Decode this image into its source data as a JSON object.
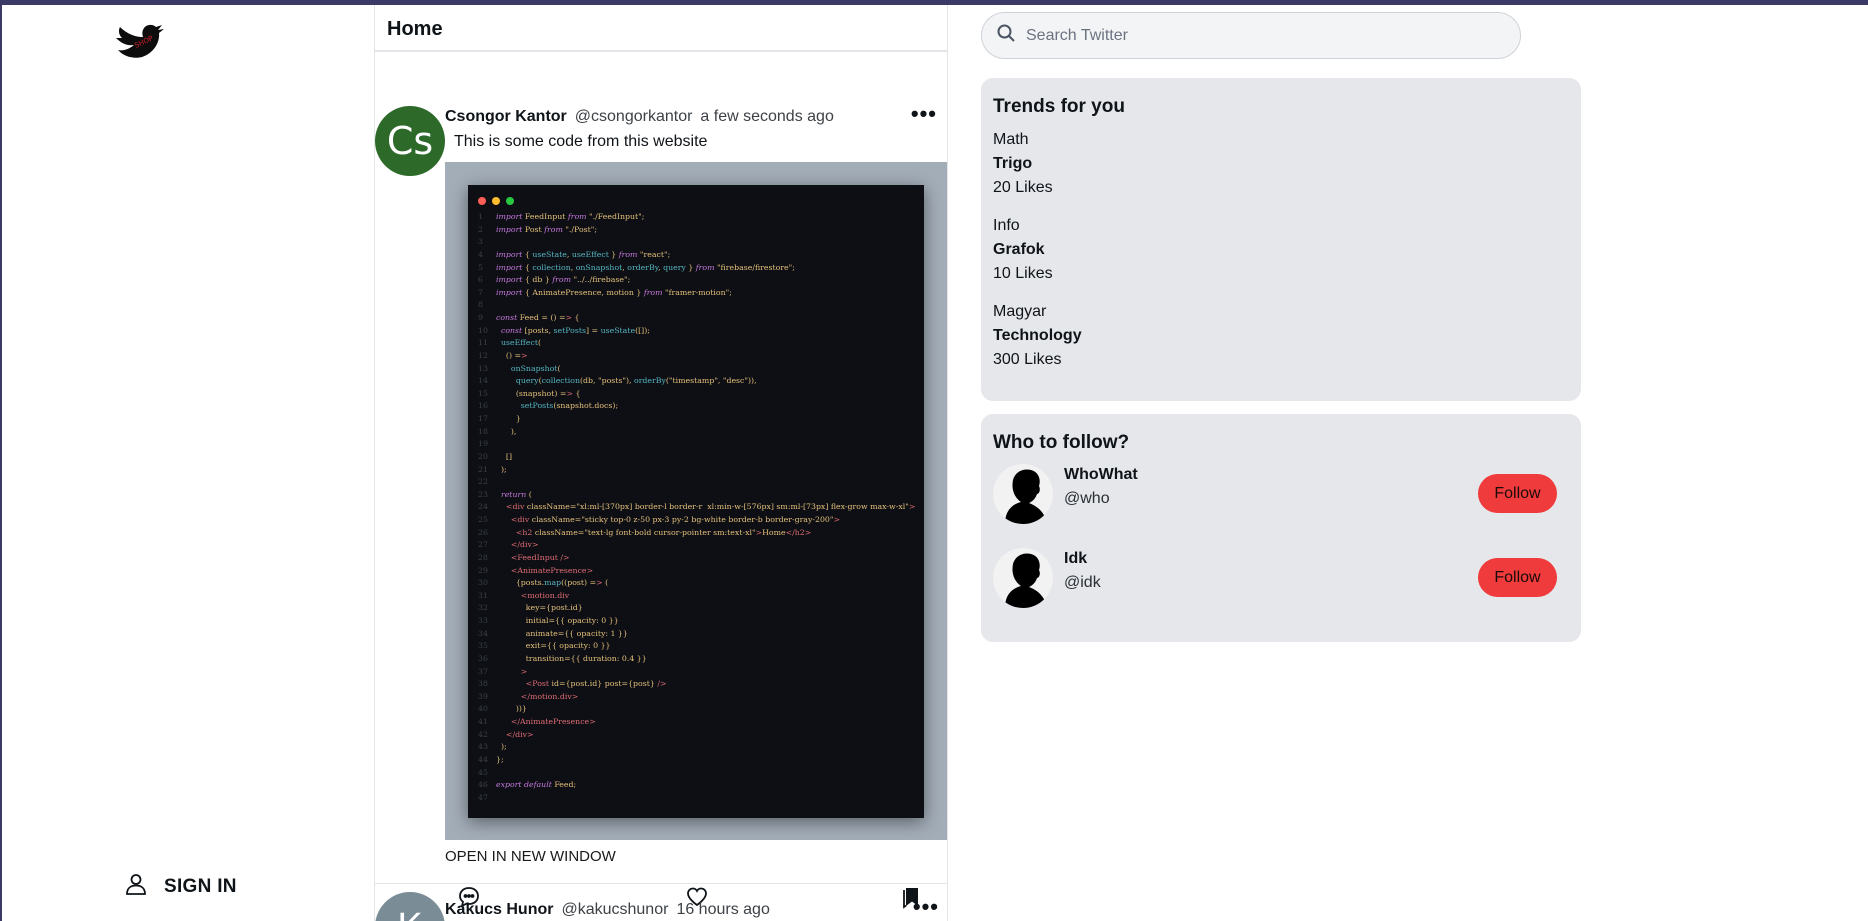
{
  "colors": {
    "accent": "#ef3b3b",
    "frame": "#3b3966",
    "panel": "#e5e7eb",
    "avatar_green": "#2d6a2a"
  },
  "sidebar": {
    "logo_icon": "twitter-bird-icon",
    "signin_label": "SIGN IN",
    "signin_icon": "user-icon"
  },
  "feed": {
    "title": "Home",
    "posts": [
      {
        "avatar_text": "Cs",
        "name": "Csongor Kantor",
        "handle": "@csongorkantor",
        "time": "a few seconds ago",
        "text": "This is some code from this website",
        "link": "OPEN IN NEW WINDOW",
        "more_icon": "more-dots-icon",
        "actions": [
          "comment-icon",
          "heart-icon",
          "bookmark-icon"
        ]
      },
      {
        "avatar_text": "K",
        "name": "Kakucs Hunor",
        "handle": "@kakucshunor",
        "time": "16 hours ago"
      }
    ]
  },
  "code_lines": [
    "import FeedInput from \"./FeedInput\";",
    "import Post from \"./Post\";",
    "",
    "import { useState, useEffect } from \"react\";",
    "import { collection, onSnapshot, orderBy, query } from \"firebase/firestore\";",
    "import { db } from \"../../firebase\";",
    "import { AnimatePresence, motion } from \"framer-motion\";",
    "",
    "const Feed = () => {",
    "  const [posts, setPosts] = useState([]);",
    "  useEffect(",
    "    () =>",
    "      onSnapshot(",
    "        query(collection(db, \"posts\"), orderBy(\"timestamp\", \"desc\")),",
    "        (snapshot) => {",
    "          setPosts(snapshot.docs);",
    "        }",
    "      ),",
    "",
    "    []",
    "  );",
    "",
    "  return (",
    "    <div className=\"xl:ml-[370px] border-l border-r  xl:min-w-[576px] sm:ml-[73px] flex-grow max-w-xl\">",
    "      <div className=\"sticky top-0 z-50 px-3 py-2 bg-white border-b border-gray-200\">",
    "        <h2 className=\"text-lg font-bold cursor-pointer sm:text-xl\">Home</h2>",
    "      </div>",
    "      <FeedInput />",
    "      <AnimatePresence>",
    "        {posts.map((post) => (",
    "          <motion.div",
    "            key={post.id}",
    "            initial={{ opacity: 0 }}",
    "            animate={{ opacity: 1 }}",
    "            exit={{ opacity: 0 }}",
    "            transition={{ duration: 0.4 }}",
    "          >",
    "            <Post id={post.id} post={post} />",
    "          </motion.div>",
    "        ))}",
    "      </AnimatePresence>",
    "    </div>",
    "  );",
    "};",
    "",
    "export default Feed;",
    ""
  ],
  "search": {
    "placeholder": "Search Twitter",
    "icon": "search-icon"
  },
  "trends": {
    "title": "Trends for you",
    "items": [
      {
        "category": "Math",
        "topic": "Trigo",
        "likes": "20 Likes"
      },
      {
        "category": "Info",
        "topic": "Grafok",
        "likes": "10 Likes"
      },
      {
        "category": "Magyar",
        "topic": "Technology",
        "likes": "300 Likes"
      }
    ]
  },
  "who_to_follow": {
    "title": "Who to follow?",
    "users": [
      {
        "name": "WhoWhat",
        "handle": "@who",
        "button": "Follow"
      },
      {
        "name": "Idk",
        "handle": "@idk",
        "button": "Follow"
      }
    ]
  }
}
